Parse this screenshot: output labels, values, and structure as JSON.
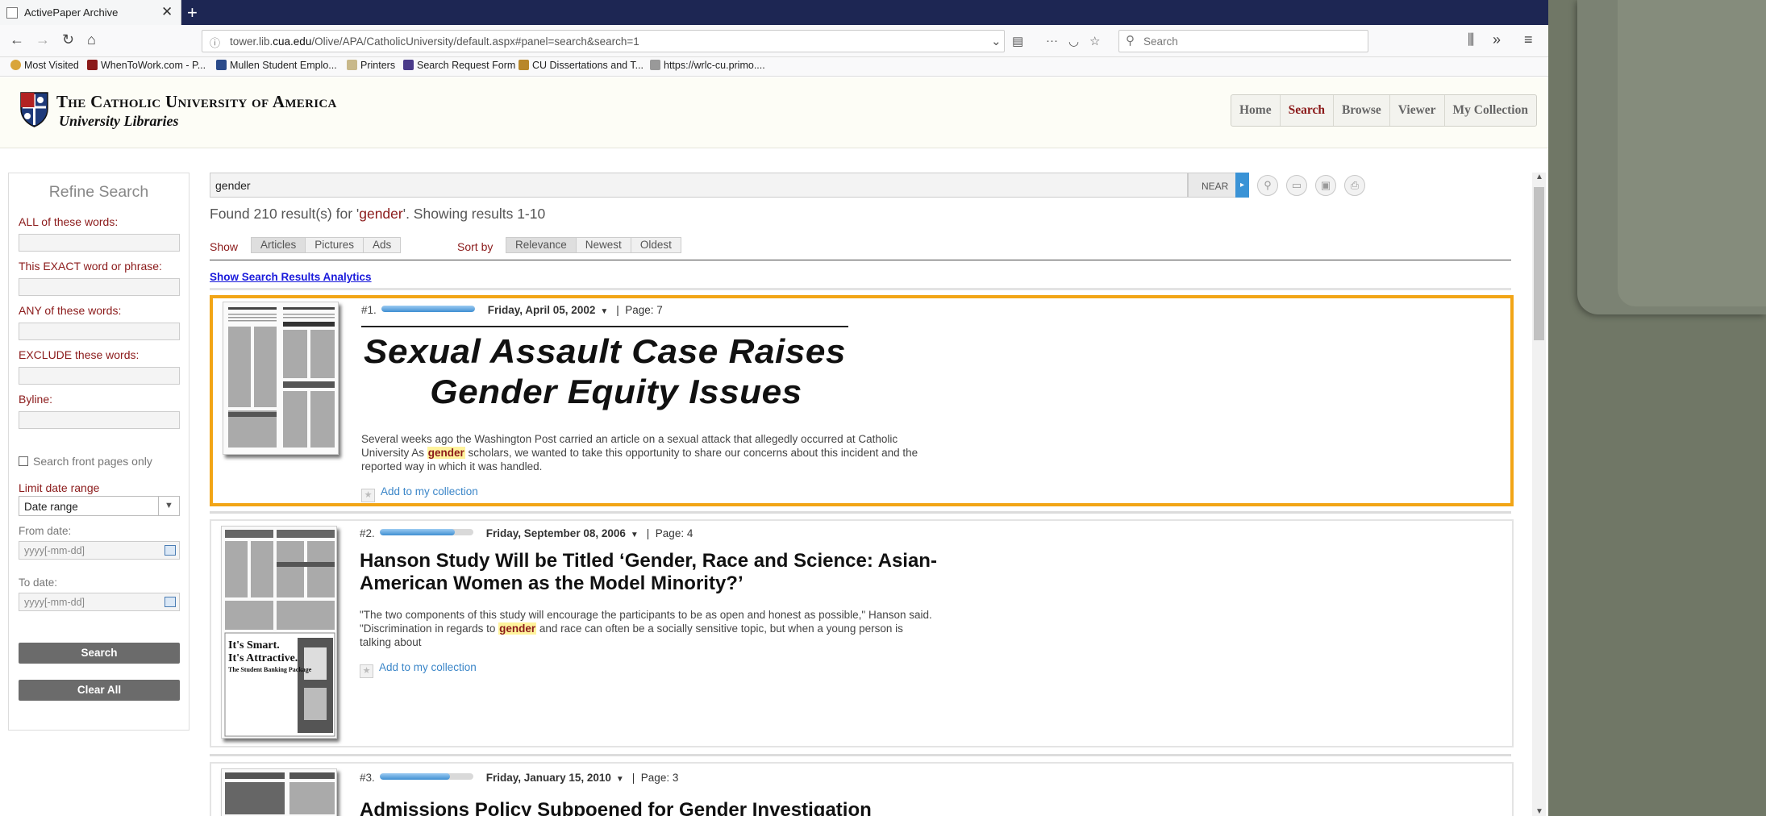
{
  "browser": {
    "tab_title": "ActivePaper Archive",
    "tab_close": "✕",
    "new_tab": "+",
    "url_prefix": "tower.lib.",
    "url_domain": "cua.edu",
    "url_rest": "/Olive/APA/CatholicUniversity/default.aspx#panel=search&search=1",
    "search_placeholder": "Search",
    "bookmarks": [
      {
        "label": "Most Visited",
        "color": "#d9a53a"
      },
      {
        "label": "WhenToWork.com - P...",
        "color": "#8b1a1a"
      },
      {
        "label": "Mullen Student Emplo...",
        "color": "#2a4a8a"
      },
      {
        "label": "Printers",
        "color": "#c8b88a"
      },
      {
        "label": "Search Request Form",
        "color": "#4a3a8a"
      },
      {
        "label": "CU Dissertations and T...",
        "color": "#b8872a"
      },
      {
        "label": "https://wrlc-cu.primo....",
        "color": "#999999"
      }
    ]
  },
  "site": {
    "name": "The Catholic University of America",
    "subtitle": "University Libraries",
    "nav": [
      "Home",
      "Search",
      "Browse",
      "Viewer",
      "My Collection"
    ],
    "active_nav": "Search"
  },
  "sidebar": {
    "title": "Refine Search",
    "all_words": "ALL of these words:",
    "exact_phrase": "This EXACT word or phrase:",
    "any_words": "ANY of these words:",
    "exclude_words": "EXCLUDE these words:",
    "byline": "Byline:",
    "front_pages": "Search front pages only",
    "limit_date": "Limit date range",
    "date_range_value": "Date range",
    "from_date": "From date:",
    "to_date": "To date:",
    "date_placeholder": "yyyy[-mm-dd]",
    "search_button": "Search",
    "clear_button": "Clear All"
  },
  "search": {
    "query": "gender",
    "near_label": "NEAR",
    "found_prefix": "Found 210 result(s) for '",
    "found_term": "gender",
    "found_suffix": "'. Showing results 1-10",
    "show_label": "Show",
    "show_options": [
      "Articles",
      "Pictures",
      "Ads"
    ],
    "sort_label": "Sort by",
    "sort_options": [
      "Relevance",
      "Newest",
      "Oldest"
    ],
    "analytics_link": "Show Search Results Analytics"
  },
  "results": [
    {
      "num": "#1.",
      "relevance": 1.0,
      "date": "Friday, April 05, 2002",
      "page": "Page: 7",
      "headline_line1": "Sexual Assault Case Raises",
      "headline_line2": "Gender Equity Issues",
      "snippet_before": "Several weeks ago the Washington Post carried an article on a sexual attack that allegedly occurred at Catholic University As ",
      "snippet_term": "gender",
      "snippet_after": " scholars, we wanted to take this opportunity to share our concerns about this incident and the reported way in which it was handled.",
      "add_label": "Add to my collection"
    },
    {
      "num": "#2.",
      "relevance": 0.8,
      "date": "Friday, September 08, 2006",
      "page": "Page: 4",
      "headline": "Hanson Study Will be Titled ‘Gender, Race and Science: Asian-American Women as the Model Minority?’",
      "snippet_before": "\"The two components of this study will encourage the participants to be as open and honest as possible,\" Hanson said. \"Discrimination in regards to ",
      "snippet_term": "gender",
      "snippet_after": " and race can often be a socially sensitive topic, but when a young person is talking about",
      "add_label": "Add to my collection",
      "thumb_ad1": "It's Smart.",
      "thumb_ad2": "It's Attractive.",
      "thumb_ad3": "The Student Banking Package"
    },
    {
      "num": "#3.",
      "relevance": 0.75,
      "date": "Friday, January 15, 2010",
      "page": "Page: 3",
      "headline": "Admissions Policy Subpoened for Gender Investigation"
    }
  ]
}
